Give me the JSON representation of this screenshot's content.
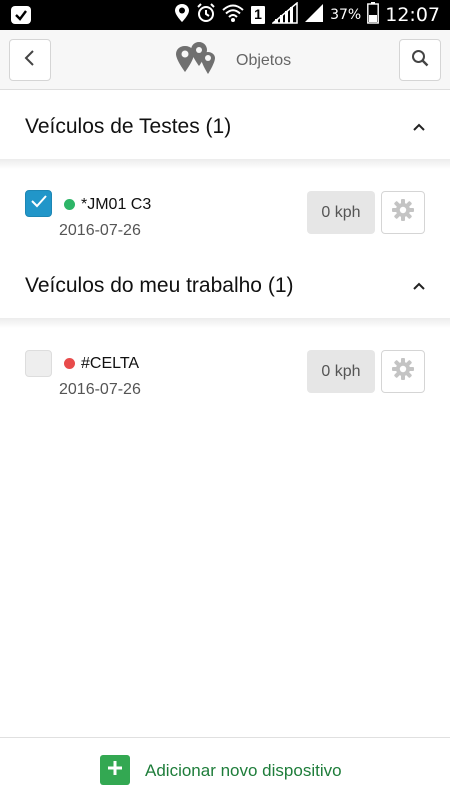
{
  "status_bar": {
    "battery_percent": "37%",
    "time": "12:07",
    "sim_label": "1"
  },
  "header": {
    "title": "Objetos",
    "back_icon": "chevron-left-icon",
    "search_icon": "search-icon",
    "logo_icon": "map-pins-logo-icon"
  },
  "groups": [
    {
      "title": "Veículos de Testes (1)",
      "expanded": true,
      "devices": [
        {
          "name": "*JM01 C3",
          "date": "2016-07-26",
          "speed": "0 kph",
          "checked": true,
          "status_color": "#2db567"
        }
      ]
    },
    {
      "title": "Veículos do meu trabalho (1)",
      "expanded": true,
      "devices": [
        {
          "name": "#CELTA",
          "date": "2016-07-26",
          "speed": "0 kph",
          "checked": false,
          "status_color": "#e84b4b"
        }
      ]
    }
  ],
  "footer": {
    "add_label": "Adicionar novo dispositivo",
    "add_icon": "plus-icon",
    "accent_color": "#33a852"
  }
}
